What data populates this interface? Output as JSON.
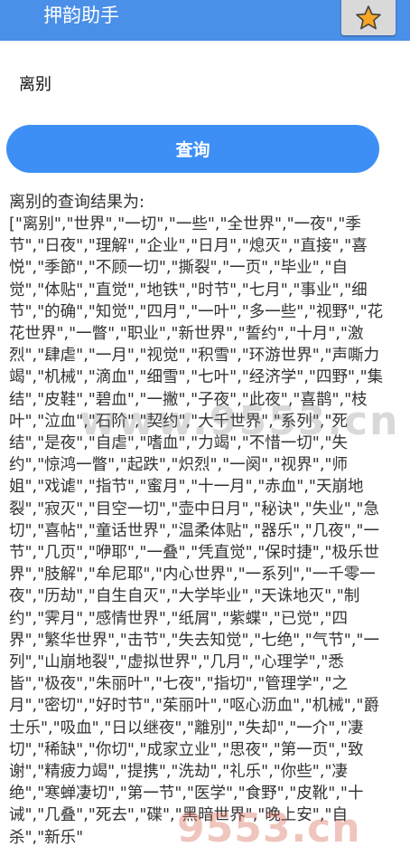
{
  "header": {
    "title": "押韵助手",
    "favorite_icon": "star-icon",
    "accent_color": "#4a8fe8",
    "star_color": "#f5a623"
  },
  "search": {
    "value": "离别"
  },
  "actions": {
    "query_label": "查询",
    "button_color": "#3d8ff5"
  },
  "results": {
    "heading": "离别的查询结果为:",
    "text": "[\"离别\",\"世界\",\"一切\",\"一些\",\"全世界\",\"一夜\",\"季节\",\"日夜\",\"理解\",\"企业\",\"日月\",\"熄灭\",\"直接\",\"喜悦\",\"季節\",\"不顾一切\",\"撕裂\",\"一页\",\"毕业\",\"自觉\",\"体贴\",\"直觉\",\"地铁\",\"时节\",\"七月\",\"事业\",\"细节\",\"的确\",\"知觉\",\"四月\",\"一叶\",\"多一些\",\"视野\",\"花花世界\",\"一瞥\",\"职业\",\"新世界\",\"誓约\",\"十月\",\"激烈\",\"肆虐\",\"一月\",\"视觉\",\"积雪\",\"环游世界\",\"声嘶力竭\",\"机械\",\"滴血\",\"细雪\",\"七叶\",\"经济学\",\"四野\",\"集结\",\"皮鞋\",\"碧血\",\"一撇\",\"子夜\",\"此夜\",\"喜鹊\",\"枝叶\",\"泣血\",\"石阶\",\"契约\",\"大千世界\",\"系列\",\"死结\",\"是夜\",\"自虐\",\"嗜血\",\"力竭\",\"不惜一切\",\"失约\",\"惊鸿一瞥\",\"起跌\",\"炽烈\",\"一阕\",\"视界\",\"师姐\",\"戏谑\",\"指节\",\"蜜月\",\"十一月\",\"赤血\",\"天崩地裂\",\"寂灭\",\"目空一切\",\"壶中日月\",\"秘诀\",\"失业\",\"急切\",\"喜帖\",\"童话世界\",\"温柔体贴\",\"器乐\",\"几夜\",\"一节\",\"几页\",\"咿耶\",\"一叠\",\"凭直觉\",\"保时捷\",\"极乐世界\",\"肢解\",\"牟尼耶\",\"内心世界\",\"一系列\",\"一千零一夜\",\"历劫\",\"自生自灭\",\"大学毕业\",\"天诛地灭\",\"制约\",\"霁月\",\"感情世界\",\"纸屑\",\"紫蝶\",\"已觉\",\"四界\",\"繁华世界\",\"击节\",\"失去知觉\",\"七绝\",\"气节\",\"一列\",\"山崩地裂\",\"虚拟世界\",\"几月\",\"心理学\",\"悉皆\",\"极夜\",\"朱丽叶\",\"七夜\",\"指切\",\"管理学\",\"之月\",\"密切\",\"好时节\",\"茱丽叶\",\"呕心沥血\",\"机械\",\"爵士乐\",\"吸血\",\"日以继夜\",\"離別\",\"失却\",\"一介\",\"凄切\",\"稀缺\",\"你切\",\"成家立业\",\"思夜\",\"第一页\",\"致谢\",\"精疲力竭\",\"提携\",\"洗劫\",\"礼乐\",\"你些\",\"凄绝\",\"寒蝉凄切\",\"第一节\",\"医学\",\"食野\",\"皮靴\",\"十诫\",\"几叠\",\"死去\",\"碟\",\"黑暗世界\",\"晚上安\",\"自杀\",\"新乐\""
  },
  "watermarks": {
    "center": "www.9553.cn",
    "bottom": "9553.cn"
  }
}
